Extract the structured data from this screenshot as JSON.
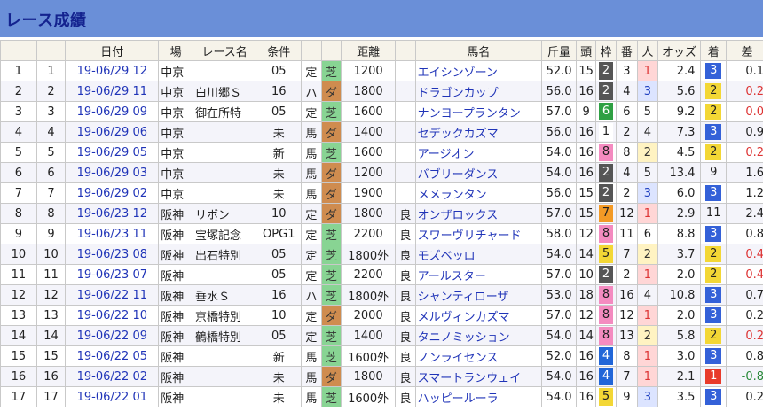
{
  "title": "レース成績",
  "headers": [
    "",
    "",
    "日付",
    "場",
    "レース名",
    "条件",
    "",
    "",
    "距離",
    "",
    "馬名",
    "斤量",
    "頭",
    "枠",
    "番",
    "人",
    "オッズ",
    "着",
    "差"
  ],
  "colors": {
    "title_bg": "#6a8fd8",
    "title_text": "#14238f",
    "link": "#2034b8",
    "turf": "#88d493",
    "dirt": "#cf8c4f",
    "waku": {
      "1": "#ffffff",
      "2": "#555555",
      "3": "#e83a3a",
      "4": "#2166d8",
      "5": "#f3d735",
      "6": "#2ea043",
      "7": "#f39a25",
      "8": "#f48bc0"
    },
    "pos_first": "#e83a2a",
    "pos_second": "#f3d735",
    "pos_third": "#3461d8",
    "pop1_bg": "#ffd6d6",
    "pop1_text": "#d33",
    "pop2_bg": "#fff3c2",
    "pop2_text": "#333",
    "pop3_bg": "#dce4ff",
    "pop3_text": "#2040c0",
    "diff_pos": "#d33",
    "diff_neg": "#2a8a3a"
  },
  "rows": [
    {
      "no": "1",
      "no2": "1",
      "date": "19-06/29 12",
      "place": "中京",
      "race": "",
      "cond": "05",
      "cond2": "定",
      "surface": "芝",
      "dist": "1200",
      "state": "",
      "horse": "エイシンゾーン",
      "weight": "52.0",
      "heads": "15",
      "waku": "2",
      "ban": "3",
      "pop": "1",
      "odds": "2.4",
      "pos": "3",
      "diff": "0.1"
    },
    {
      "no": "2",
      "no2": "2",
      "date": "19-06/29 11",
      "place": "中京",
      "race": "白川郷Ｓ",
      "cond": "16",
      "cond2": "ハ",
      "surface": "ダ",
      "dist": "1800",
      "state": "",
      "horse": "ドラゴンカップ",
      "weight": "56.0",
      "heads": "16",
      "waku": "2",
      "ban": "4",
      "pop": "3",
      "odds": "5.6",
      "pos": "2",
      "diff": "0.2"
    },
    {
      "no": "3",
      "no2": "3",
      "date": "19-06/29 09",
      "place": "中京",
      "race": "御在所特",
      "cond": "05",
      "cond2": "定",
      "surface": "芝",
      "dist": "1600",
      "state": "",
      "horse": "ナンヨープランタン",
      "weight": "57.0",
      "heads": "9",
      "waku": "6",
      "ban": "6",
      "pop": "5",
      "odds": "9.2",
      "pos": "2",
      "diff": "0.0"
    },
    {
      "no": "4",
      "no2": "4",
      "date": "19-06/29 06",
      "place": "中京",
      "race": "",
      "cond": "未",
      "cond2": "馬",
      "surface": "ダ",
      "dist": "1400",
      "state": "",
      "horse": "セデックカズマ",
      "weight": "56.0",
      "heads": "16",
      "waku": "1",
      "ban": "2",
      "pop": "4",
      "odds": "7.3",
      "pos": "3",
      "diff": "0.9"
    },
    {
      "no": "5",
      "no2": "5",
      "date": "19-06/29 05",
      "place": "中京",
      "race": "",
      "cond": "新",
      "cond2": "馬",
      "surface": "芝",
      "dist": "1600",
      "state": "",
      "horse": "アージオン",
      "weight": "54.0",
      "heads": "16",
      "waku": "8",
      "ban": "8",
      "pop": "2",
      "odds": "4.5",
      "pos": "2",
      "diff": "0.2"
    },
    {
      "no": "6",
      "no2": "6",
      "date": "19-06/29 03",
      "place": "中京",
      "race": "",
      "cond": "未",
      "cond2": "馬",
      "surface": "ダ",
      "dist": "1200",
      "state": "",
      "horse": "バブリーダンス",
      "weight": "54.0",
      "heads": "16",
      "waku": "2",
      "ban": "4",
      "pop": "5",
      "odds": "13.4",
      "pos": "9",
      "diff": "1.6"
    },
    {
      "no": "7",
      "no2": "7",
      "date": "19-06/29 02",
      "place": "中京",
      "race": "",
      "cond": "未",
      "cond2": "馬",
      "surface": "ダ",
      "dist": "1900",
      "state": "",
      "horse": "メメランタン",
      "weight": "56.0",
      "heads": "15",
      "waku": "2",
      "ban": "2",
      "pop": "3",
      "odds": "6.0",
      "pos": "3",
      "diff": "1.2"
    },
    {
      "no": "8",
      "no2": "8",
      "date": "19-06/23 12",
      "place": "阪神",
      "race": "リボン",
      "cond": "10",
      "cond2": "定",
      "surface": "ダ",
      "dist": "1800",
      "state": "良",
      "horse": "オンザロックス",
      "weight": "57.0",
      "heads": "15",
      "waku": "7",
      "ban": "12",
      "pop": "1",
      "odds": "2.9",
      "pos": "11",
      "diff": "2.4"
    },
    {
      "no": "9",
      "no2": "9",
      "date": "19-06/23 11",
      "place": "阪神",
      "race": "宝塚記念",
      "cond": "OPG1",
      "cond2": "定",
      "surface": "芝",
      "dist": "2200",
      "state": "良",
      "horse": "スワーヴリチャード",
      "weight": "58.0",
      "heads": "12",
      "waku": "8",
      "ban": "11",
      "pop": "6",
      "odds": "8.8",
      "pos": "3",
      "diff": "0.8"
    },
    {
      "no": "10",
      "no2": "10",
      "date": "19-06/23 08",
      "place": "阪神",
      "race": "出石特別",
      "cond": "05",
      "cond2": "定",
      "surface": "芝",
      "dist": "1800外",
      "state": "良",
      "horse": "モズベッロ",
      "weight": "54.0",
      "heads": "14",
      "waku": "5",
      "ban": "7",
      "pop": "2",
      "odds": "3.7",
      "pos": "2",
      "diff": "0.4"
    },
    {
      "no": "11",
      "no2": "11",
      "date": "19-06/23 07",
      "place": "阪神",
      "race": "",
      "cond": "05",
      "cond2": "定",
      "surface": "芝",
      "dist": "2200",
      "state": "良",
      "horse": "アールスター",
      "weight": "57.0",
      "heads": "10",
      "waku": "2",
      "ban": "2",
      "pop": "1",
      "odds": "2.0",
      "pos": "2",
      "diff": "0.4"
    },
    {
      "no": "12",
      "no2": "12",
      "date": "19-06/22 11",
      "place": "阪神",
      "race": "垂水Ｓ",
      "cond": "16",
      "cond2": "ハ",
      "surface": "芝",
      "dist": "1800外",
      "state": "良",
      "horse": "シャンティローザ",
      "weight": "53.0",
      "heads": "18",
      "waku": "8",
      "ban": "16",
      "pop": "4",
      "odds": "10.8",
      "pos": "3",
      "diff": "0.7"
    },
    {
      "no": "13",
      "no2": "13",
      "date": "19-06/22 10",
      "place": "阪神",
      "race": "京橋特別",
      "cond": "10",
      "cond2": "定",
      "surface": "ダ",
      "dist": "2000",
      "state": "良",
      "horse": "メルヴィンカズマ",
      "weight": "57.0",
      "heads": "12",
      "waku": "8",
      "ban": "12",
      "pop": "1",
      "odds": "2.0",
      "pos": "3",
      "diff": "0.2"
    },
    {
      "no": "14",
      "no2": "14",
      "date": "19-06/22 09",
      "place": "阪神",
      "race": "鶴橋特別",
      "cond": "05",
      "cond2": "定",
      "surface": "芝",
      "dist": "1400",
      "state": "良",
      "horse": "タニノミッション",
      "weight": "54.0",
      "heads": "14",
      "waku": "8",
      "ban": "13",
      "pop": "2",
      "odds": "5.8",
      "pos": "2",
      "diff": "0.2"
    },
    {
      "no": "15",
      "no2": "15",
      "date": "19-06/22 05",
      "place": "阪神",
      "race": "",
      "cond": "新",
      "cond2": "馬",
      "surface": "芝",
      "dist": "1600外",
      "state": "良",
      "horse": "ノンライセンス",
      "weight": "52.0",
      "heads": "16",
      "waku": "4",
      "ban": "8",
      "pop": "1",
      "odds": "3.0",
      "pos": "3",
      "diff": "0.8"
    },
    {
      "no": "16",
      "no2": "16",
      "date": "19-06/22 02",
      "place": "阪神",
      "race": "",
      "cond": "未",
      "cond2": "馬",
      "surface": "ダ",
      "dist": "1800",
      "state": "良",
      "horse": "スマートランウェイ",
      "weight": "54.0",
      "heads": "16",
      "waku": "4",
      "ban": "7",
      "pop": "1",
      "odds": "2.1",
      "pos": "1",
      "diff": "-0.8"
    },
    {
      "no": "17",
      "no2": "17",
      "date": "19-06/22 01",
      "place": "阪神",
      "race": "",
      "cond": "未",
      "cond2": "馬",
      "surface": "芝",
      "dist": "1600外",
      "state": "良",
      "horse": "ハッピールーラ",
      "weight": "54.0",
      "heads": "16",
      "waku": "5",
      "ban": "9",
      "pop": "3",
      "odds": "3.5",
      "pos": "3",
      "diff": "0.2"
    }
  ]
}
